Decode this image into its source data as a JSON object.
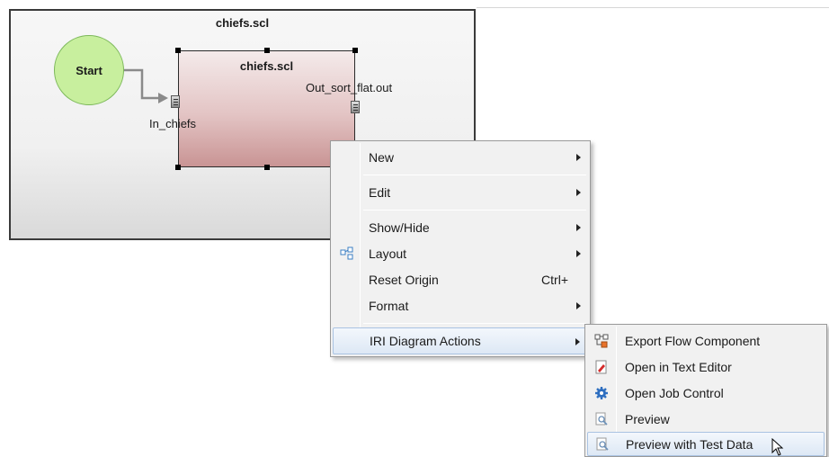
{
  "diagram": {
    "canvas_title": "chiefs.scl",
    "start_node": "Start",
    "component_title": "chiefs.scl",
    "input_port": "In_chiefs",
    "output_port": "Out_sort_flat.out"
  },
  "context_menu": {
    "items": [
      {
        "label": "New",
        "submenu": true
      },
      {
        "label": "Edit",
        "submenu": true
      },
      {
        "label": "Show/Hide",
        "submenu": true
      },
      {
        "label": "Layout",
        "submenu": true,
        "icon": "layout-icon"
      },
      {
        "label": "Reset Origin",
        "shortcut": "Ctrl+"
      },
      {
        "label": "Format",
        "submenu": true
      },
      {
        "label": "IRI Diagram Actions",
        "submenu": true,
        "highlighted": true
      }
    ]
  },
  "submenu": {
    "items": [
      {
        "label": "Export Flow Component",
        "icon": "export-flow-icon"
      },
      {
        "label": "Open in Text Editor",
        "icon": "text-editor-icon"
      },
      {
        "label": "Open Job Control",
        "icon": "gear-icon"
      },
      {
        "label": "Preview",
        "icon": "preview-icon"
      },
      {
        "label": "Preview with Test Data",
        "icon": "preview-icon",
        "highlighted": true
      }
    ]
  },
  "colors": {
    "start_fill": "#c8ef9e",
    "component_fill": "#c99494",
    "highlight": "#dde8f5",
    "menu_bg": "#f1f1f1"
  }
}
